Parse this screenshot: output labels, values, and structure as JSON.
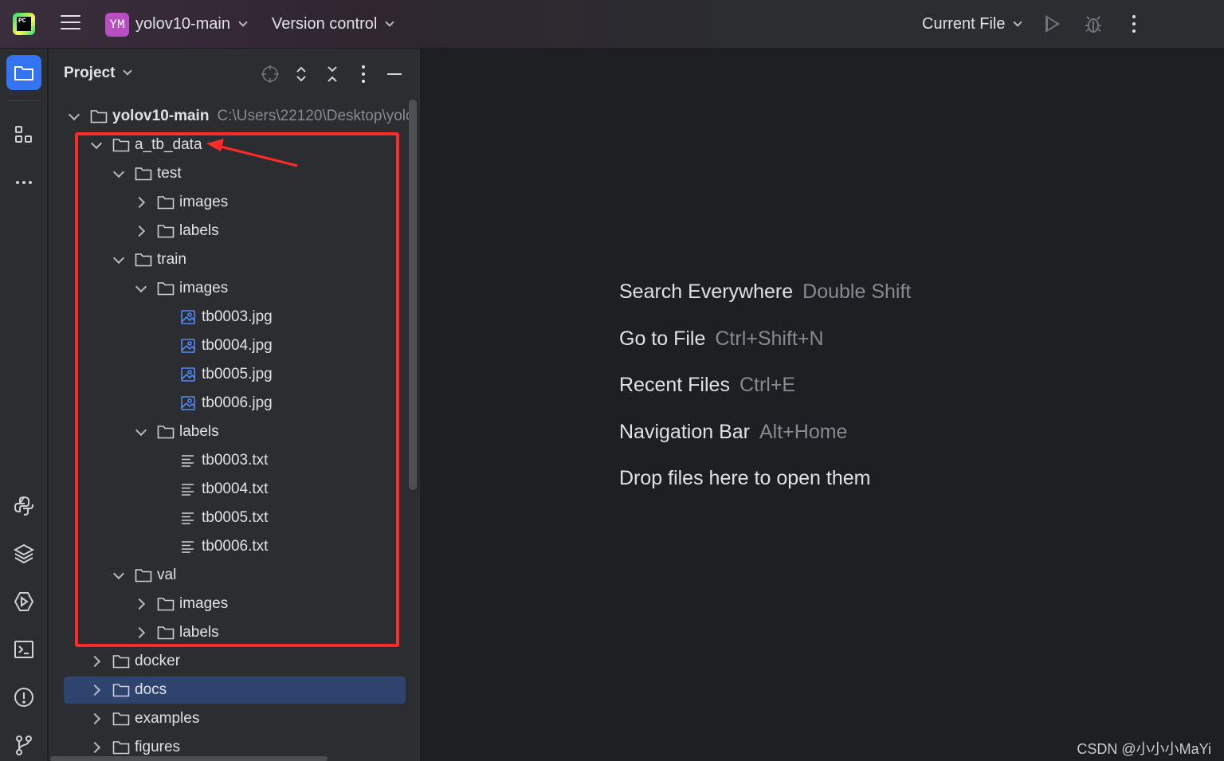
{
  "titlebar": {
    "project_badge": "YM",
    "project_name": "yolov10-main",
    "version_control": "Version control",
    "run_config": "Current File"
  },
  "project_panel": {
    "title": "Project",
    "tree": [
      {
        "label": "yolov10-main",
        "hint": "C:\\Users\\22120\\Desktop\\yolo",
        "type": "folder",
        "depth": 0,
        "expanded": true,
        "bold": true
      },
      {
        "label": "a_tb_data",
        "type": "folder",
        "depth": 1,
        "expanded": true
      },
      {
        "label": "test",
        "type": "folder",
        "depth": 2,
        "expanded": true
      },
      {
        "label": "images",
        "type": "folder",
        "depth": 3,
        "expanded": false
      },
      {
        "label": "labels",
        "type": "folder",
        "depth": 3,
        "expanded": false
      },
      {
        "label": "train",
        "type": "folder",
        "depth": 2,
        "expanded": true
      },
      {
        "label": "images",
        "type": "folder",
        "depth": 3,
        "expanded": true
      },
      {
        "label": "tb0003.jpg",
        "type": "image",
        "depth": 4
      },
      {
        "label": "tb0004.jpg",
        "type": "image",
        "depth": 4
      },
      {
        "label": "tb0005.jpg",
        "type": "image",
        "depth": 4
      },
      {
        "label": "tb0006.jpg",
        "type": "image",
        "depth": 4
      },
      {
        "label": "labels",
        "type": "folder",
        "depth": 3,
        "expanded": true
      },
      {
        "label": "tb0003.txt",
        "type": "text",
        "depth": 4
      },
      {
        "label": "tb0004.txt",
        "type": "text",
        "depth": 4
      },
      {
        "label": "tb0005.txt",
        "type": "text",
        "depth": 4
      },
      {
        "label": "tb0006.txt",
        "type": "text",
        "depth": 4
      },
      {
        "label": "val",
        "type": "folder",
        "depth": 2,
        "expanded": true
      },
      {
        "label": "images",
        "type": "folder",
        "depth": 3,
        "expanded": false
      },
      {
        "label": "labels",
        "type": "folder",
        "depth": 3,
        "expanded": false
      },
      {
        "label": "docker",
        "type": "folder",
        "depth": 1,
        "expanded": false
      },
      {
        "label": "docs",
        "type": "folder",
        "depth": 1,
        "expanded": false,
        "selected": true
      },
      {
        "label": "examples",
        "type": "folder",
        "depth": 1,
        "expanded": false
      },
      {
        "label": "figures",
        "type": "folder",
        "depth": 1,
        "expanded": false
      }
    ]
  },
  "editor": {
    "hints": [
      {
        "action": "Search Everywhere",
        "shortcut": "Double Shift"
      },
      {
        "action": "Go to File",
        "shortcut": "Ctrl+Shift+N"
      },
      {
        "action": "Recent Files",
        "shortcut": "Ctrl+E"
      },
      {
        "action": "Navigation Bar",
        "shortcut": "Alt+Home"
      },
      {
        "action": "Drop files here to open them",
        "shortcut": ""
      }
    ]
  },
  "watermark": "CSDN @小小小MaYi",
  "colors": {
    "accent": "#3574f0",
    "selection": "#2e436e",
    "annotation": "#ff2a2a",
    "image_icon": "#548af7"
  }
}
